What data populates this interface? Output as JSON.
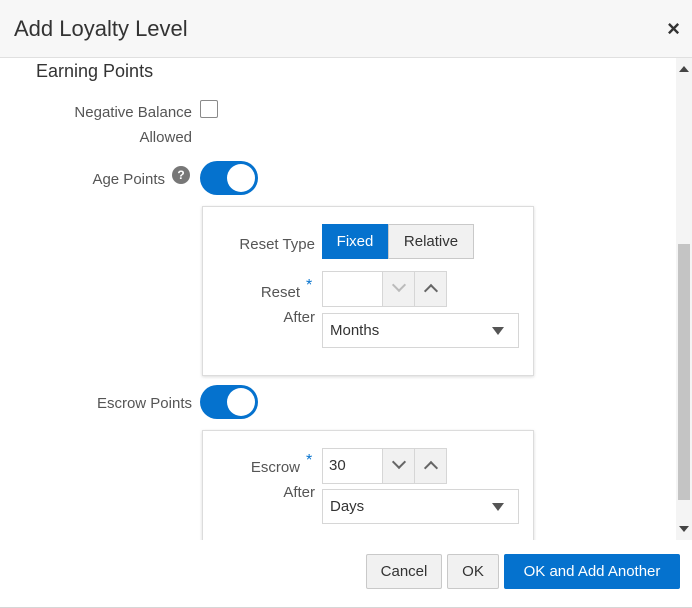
{
  "dialog": {
    "title": "Add Loyalty Level",
    "close_glyph": "×"
  },
  "section": {
    "title": "Earning Points"
  },
  "negative_balance": {
    "label_line1": "Negative Balance",
    "label_line2": "Allowed",
    "checked": false
  },
  "age_points": {
    "label": "Age Points",
    "help_glyph": "?",
    "enabled": true,
    "reset_type": {
      "label": "Reset Type",
      "options": [
        "Fixed",
        "Relative"
      ],
      "selected": "Fixed"
    },
    "reset_after": {
      "label_line1": "Reset",
      "label_line2": "After",
      "required_mark": "*",
      "value": "",
      "unit": "Months"
    }
  },
  "escrow_points": {
    "label": "Escrow Points",
    "enabled": true,
    "escrow_after": {
      "label_line1": "Escrow",
      "label_line2": "After",
      "required_mark": "*",
      "value": "30",
      "unit": "Days"
    }
  },
  "footer": {
    "cancel_label": "Cancel",
    "ok_label": "OK",
    "ok_add_label": "OK and Add Another"
  },
  "colors": {
    "accent": "#0572ce",
    "header_bg": "#f7f7f7"
  }
}
